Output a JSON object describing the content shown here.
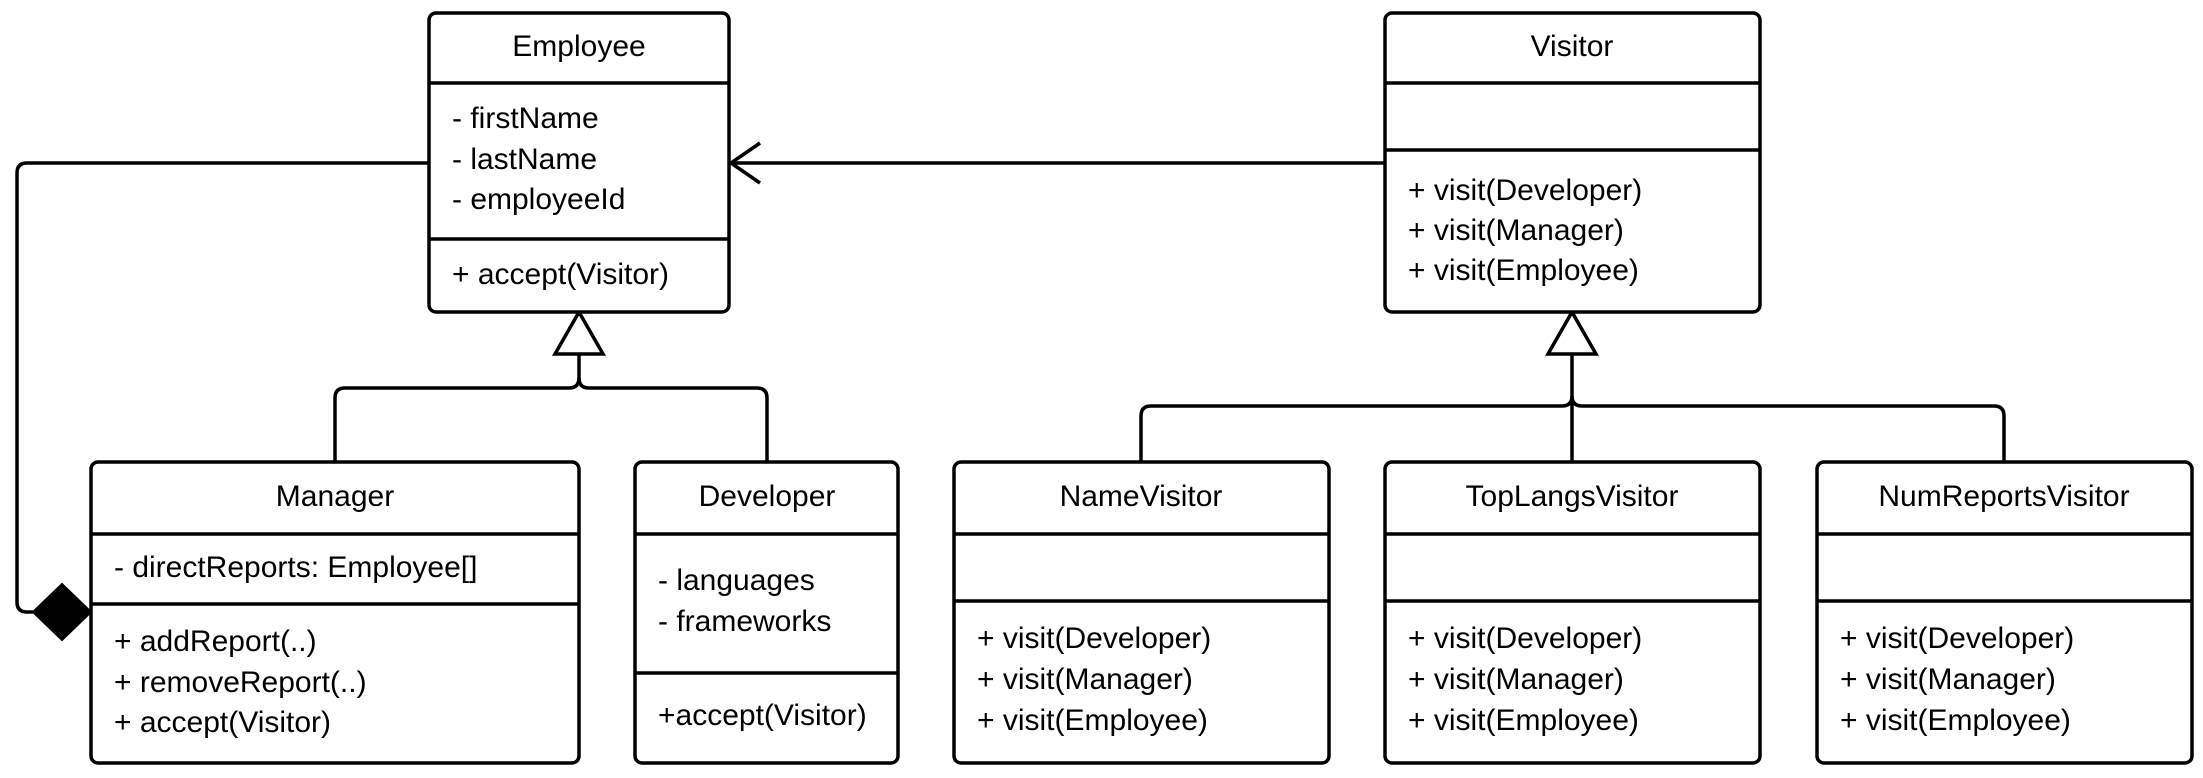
{
  "classes": {
    "employee": {
      "name": "Employee",
      "attributes": [
        "- firstName",
        "- lastName",
        "- employeeId"
      ],
      "methods": [
        "+ accept(Visitor)"
      ]
    },
    "visitor": {
      "name": "Visitor",
      "attributes": [],
      "methods": [
        "+ visit(Developer)",
        "+ visit(Manager)",
        "+ visit(Employee)"
      ]
    },
    "manager": {
      "name": "Manager",
      "attributes": [
        "- directReports: Employee[]"
      ],
      "methods": [
        "+ addReport(..)",
        "+ removeReport(..)",
        "+ accept(Visitor)"
      ]
    },
    "developer": {
      "name": "Developer",
      "attributes": [
        "- languages",
        "- frameworks"
      ],
      "methods": [
        "+accept(Visitor)"
      ]
    },
    "name_visitor": {
      "name": "NameVisitor",
      "attributes": [],
      "methods": [
        "+ visit(Developer)",
        "+ visit(Manager)",
        "+ visit(Employee)"
      ]
    },
    "top_langs_visitor": {
      "name": "TopLangsVisitor",
      "attributes": [],
      "methods": [
        "+ visit(Developer)",
        "+ visit(Manager)",
        "+ visit(Employee)"
      ]
    },
    "num_reports_visitor": {
      "name": "NumReportsVisitor",
      "attributes": [],
      "methods": [
        "+ visit(Developer)",
        "+ visit(Manager)",
        "+ visit(Employee)"
      ]
    }
  },
  "relationships": [
    {
      "type": "association",
      "from": "Visitor",
      "to": "Employee"
    },
    {
      "type": "composition",
      "from": "Employee",
      "to": "Manager"
    },
    {
      "type": "generalization",
      "from": "Manager",
      "to": "Employee"
    },
    {
      "type": "generalization",
      "from": "Developer",
      "to": "Employee"
    },
    {
      "type": "generalization",
      "from": "NameVisitor",
      "to": "Visitor"
    },
    {
      "type": "generalization",
      "from": "TopLangsVisitor",
      "to": "Visitor"
    },
    {
      "type": "generalization",
      "from": "NumReportsVisitor",
      "to": "Visitor"
    }
  ]
}
